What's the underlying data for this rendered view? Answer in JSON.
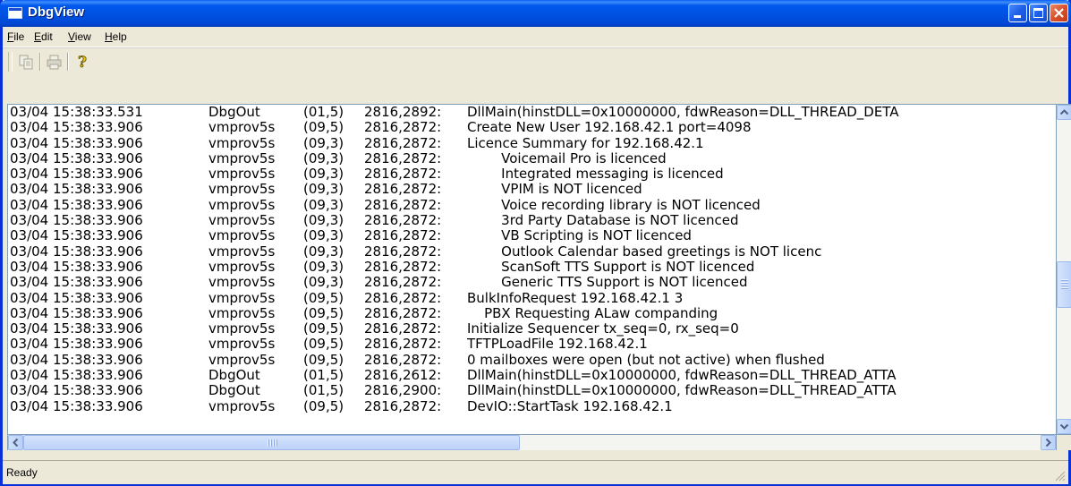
{
  "window": {
    "title": "DbgView"
  },
  "menubar": {
    "items": [
      {
        "label": "File",
        "accel": "F",
        "rest": "ile"
      },
      {
        "label": "Edit",
        "accel": "E",
        "rest": "dit"
      },
      {
        "label": "View",
        "accel": "V",
        "rest": "iew"
      },
      {
        "label": "Help",
        "accel": "H",
        "rest": "elp"
      }
    ]
  },
  "toolbar": {
    "tools": [
      {
        "icon": "copy-icon",
        "enabled": false
      },
      {
        "icon": "print-icon",
        "enabled": false
      },
      {
        "icon": "help-icon",
        "enabled": true
      }
    ]
  },
  "log": {
    "rows": [
      [
        "03/04 15:38:33.531",
        "DbgOut",
        "(01,5)",
        "2816,2892:",
        "DllMain(hinstDLL=0x10000000, fdwReason=DLL_THREAD_DETA"
      ],
      [
        "03/04 15:38:33.906",
        "vmprov5s",
        "(09,5)",
        "2816,2872:",
        "Create New User 192.168.42.1 port=4098"
      ],
      [
        "03/04 15:38:33.906",
        "vmprov5s",
        "(09,3)",
        "2816,2872:",
        "Licence Summary for 192.168.42.1"
      ],
      [
        "03/04 15:38:33.906",
        "vmprov5s",
        "(09,3)",
        "2816,2872:",
        "        Voicemail Pro is licenced"
      ],
      [
        "03/04 15:38:33.906",
        "vmprov5s",
        "(09,3)",
        "2816,2872:",
        "        Integrated messaging is licenced"
      ],
      [
        "03/04 15:38:33.906",
        "vmprov5s",
        "(09,3)",
        "2816,2872:",
        "        VPIM is NOT licenced"
      ],
      [
        "03/04 15:38:33.906",
        "vmprov5s",
        "(09,3)",
        "2816,2872:",
        "        Voice recording library is NOT licenced"
      ],
      [
        "03/04 15:38:33.906",
        "vmprov5s",
        "(09,3)",
        "2816,2872:",
        "        3rd Party Database is NOT licenced"
      ],
      [
        "03/04 15:38:33.906",
        "vmprov5s",
        "(09,3)",
        "2816,2872:",
        "        VB Scripting is NOT licenced"
      ],
      [
        "03/04 15:38:33.906",
        "vmprov5s",
        "(09,3)",
        "2816,2872:",
        "        Outlook Calendar based greetings is NOT licenc"
      ],
      [
        "03/04 15:38:33.906",
        "vmprov5s",
        "(09,3)",
        "2816,2872:",
        "        ScanSoft TTS Support is NOT licenced"
      ],
      [
        "03/04 15:38:33.906",
        "vmprov5s",
        "(09,3)",
        "2816,2872:",
        "        Generic TTS Support is NOT licenced"
      ],
      [
        "03/04 15:38:33.906",
        "vmprov5s",
        "(09,5)",
        "2816,2872:",
        "BulkInfoRequest 192.168.42.1 3"
      ],
      [
        "03/04 15:38:33.906",
        "vmprov5s",
        "(09,5)",
        "2816,2872:",
        "    PBX Requesting ALaw companding"
      ],
      [
        "03/04 15:38:33.906",
        "vmprov5s",
        "(09,5)",
        "2816,2872:",
        "Initialize Sequencer tx_seq=0, rx_seq=0"
      ],
      [
        "03/04 15:38:33.906",
        "vmprov5s",
        "(09,5)",
        "2816,2872:",
        "TFTPLoadFile 192.168.42.1"
      ],
      [
        "03/04 15:38:33.906",
        "vmprov5s",
        "(09,5)",
        "2816,2872:",
        "0 mailboxes were open (but not active) when flushed"
      ],
      [
        "03/04 15:38:33.906",
        "DbgOut",
        "(01,5)",
        "2816,2612:",
        "DllMain(hinstDLL=0x10000000, fdwReason=DLL_THREAD_ATTA"
      ],
      [
        "03/04 15:38:33.906",
        "DbgOut",
        "(01,5)",
        "2816,2900:",
        "DllMain(hinstDLL=0x10000000, fdwReason=DLL_THREAD_ATTA"
      ],
      [
        "03/04 15:38:33.906",
        "vmprov5s",
        "(09,5)",
        "2816,2872:",
        "DevIO::StartTask 192.168.42.1"
      ]
    ]
  },
  "scrollbars": {
    "vertical": {
      "up_icon": "arrow-up-icon",
      "down_icon": "arrow-down-icon",
      "position": 0.56
    },
    "horizontal": {
      "left_icon": "arrow-left-icon",
      "right_icon": "arrow-right-icon",
      "position": 0.0
    }
  },
  "statusbar": {
    "text": "Ready"
  }
}
